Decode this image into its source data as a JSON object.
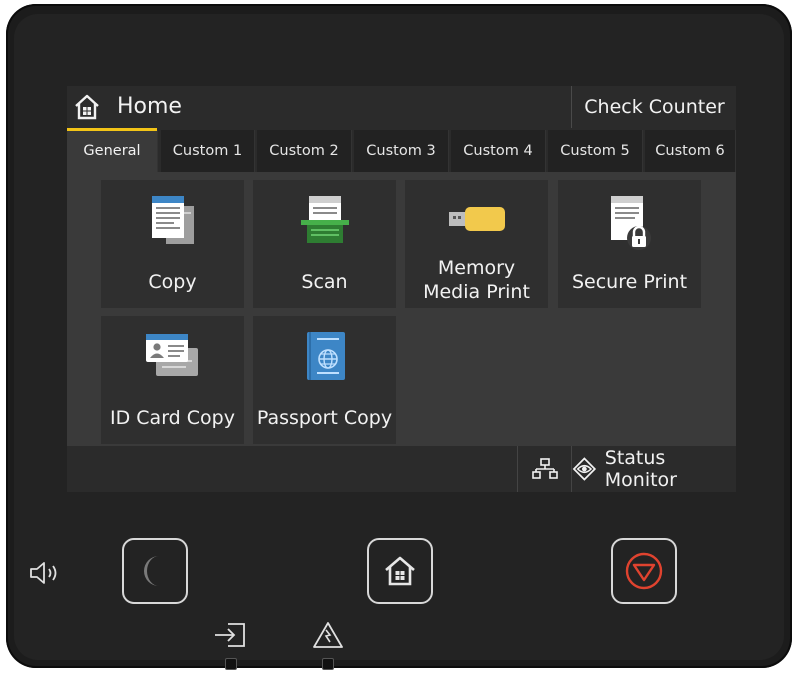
{
  "header": {
    "title": "Home",
    "check_counter": "Check Counter"
  },
  "tabs": [
    {
      "label": "General",
      "active": true
    },
    {
      "label": "Custom 1"
    },
    {
      "label": "Custom 2"
    },
    {
      "label": "Custom 3"
    },
    {
      "label": "Custom 4"
    },
    {
      "label": "Custom 5"
    },
    {
      "label": "Custom 6"
    }
  ],
  "tiles": [
    {
      "label": "Copy",
      "icon": "copy-icon"
    },
    {
      "label": "Scan",
      "icon": "scan-icon"
    },
    {
      "label_line1": "Memory",
      "label_line2": "Media Print",
      "icon": "usb-memory-icon"
    },
    {
      "label": "Secure Print",
      "icon": "secure-print-icon"
    },
    {
      "label": "ID Card Copy",
      "icon": "id-card-icon"
    },
    {
      "label": "Passport Copy",
      "icon": "passport-icon"
    }
  ],
  "statusbar": {
    "status_monitor": "Status Monitor",
    "network_icon": "network-icon"
  },
  "hardware": {
    "energy_saver_icon": "moon-icon",
    "home_icon": "home-icon",
    "stop_icon": "stop-icon",
    "speaker_icon": "speaker-icon",
    "data_indicator_icon": "data-in-icon",
    "error_indicator_icon": "warning-icon"
  },
  "colors": {
    "active_tab_accent": "#f2c417",
    "stop_button": "#e0432f",
    "screen_bg": "#3a3a3a",
    "bar_bg": "#2b2b2b"
  }
}
